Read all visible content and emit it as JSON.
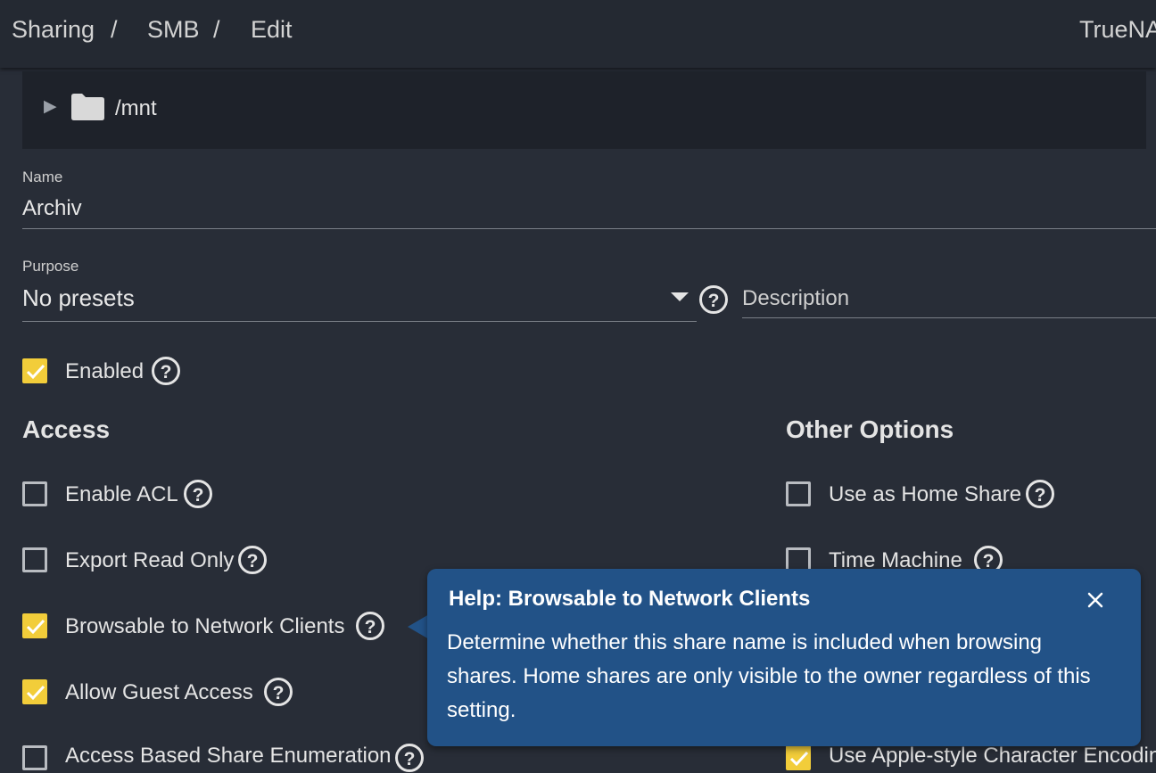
{
  "breadcrumb": {
    "sharing": "Sharing",
    "sep1": "/",
    "smb": "SMB",
    "sep2": "/",
    "edit": "Edit"
  },
  "brand": "TrueNA",
  "tree": {
    "path": "/mnt",
    "expand_icon": "triangle-right-icon",
    "folder_icon": "folder-icon"
  },
  "name_field": {
    "label": "Name",
    "value": "Archiv"
  },
  "purpose_field": {
    "label": "Purpose",
    "value": "No presets"
  },
  "description_field": {
    "placeholder": "Description"
  },
  "enabled": {
    "label": "Enabled",
    "checked": true
  },
  "access": {
    "title": "Access",
    "options": [
      {
        "label": "Enable ACL",
        "checked": false
      },
      {
        "label": "Export Read Only",
        "checked": false
      },
      {
        "label": "Browsable to Network Clients",
        "checked": true
      },
      {
        "label": "Allow Guest Access",
        "checked": true
      },
      {
        "label": "Access Based Share Enumeration",
        "checked": false
      }
    ]
  },
  "other_options": {
    "title": "Other Options",
    "options": [
      {
        "label": "Use as Home Share",
        "checked": false
      },
      {
        "label": "Time Machine",
        "checked": false
      },
      {
        "label": "Use Apple-style Character Encoding",
        "checked": true
      }
    ]
  },
  "tooltip": {
    "title": "Help: Browsable to Network Clients",
    "body": "Determine whether this share name is included when browsing shares. Home shares are only visible to the owner regardless of this setting."
  },
  "colors": {
    "accent": "#f2cd3a",
    "tooltip_bg": "#225287",
    "page_bg": "#282d37",
    "topbar_bg": "#242932"
  }
}
